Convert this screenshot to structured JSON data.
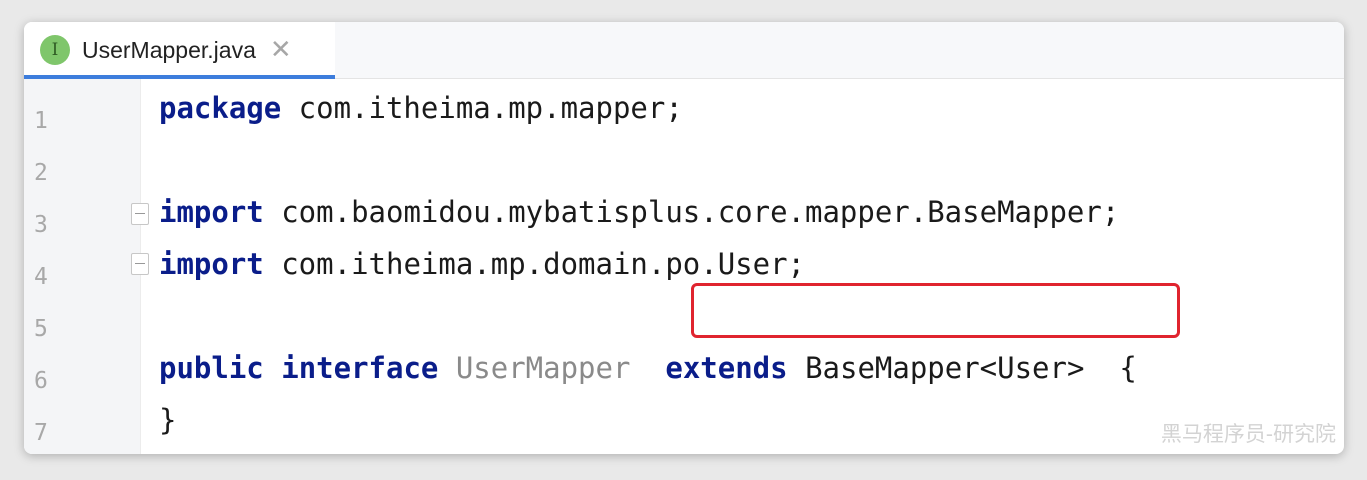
{
  "editor": {
    "tab": {
      "icon": "interface-icon",
      "icon_letter": "I",
      "filename": "UserMapper.java",
      "close_glyph": "✕"
    },
    "line_numbers": [
      "1",
      "2",
      "3",
      "4",
      "5",
      "6",
      "7"
    ],
    "code": {
      "line1": {
        "kw": "package",
        "rest": " com.itheima.mp.mapper;"
      },
      "line3": {
        "kw": "import",
        "rest": " com.baomidou.mybatisplus.core.mapper.BaseMapper;"
      },
      "line4": {
        "kw": "import",
        "rest": " com.itheima.mp.domain.po.User;"
      },
      "line6": {
        "kw1": "public",
        "kw2": "interface",
        "name": "UserMapper",
        "kw3": "extends",
        "type": "BaseMapper<User>",
        "brace": "{"
      },
      "line7": {
        "text": "}"
      }
    },
    "watermark": "黑马程序员-研究院"
  },
  "colors": {
    "keyword": "#0a1d8a",
    "highlight_box": "#e0242f",
    "tab_underline": "#3d7ddc",
    "tab_icon": "#7fc66b"
  }
}
